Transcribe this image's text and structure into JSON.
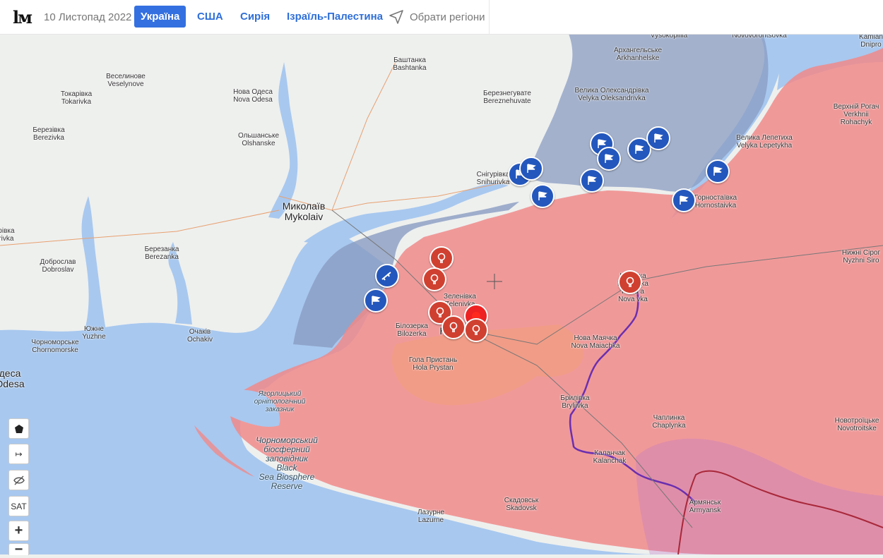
{
  "header": {
    "logo": "lм",
    "date": "10 Листопад 2022",
    "tabs": [
      {
        "label": "Україна",
        "active": true
      },
      {
        "label": "США",
        "active": false
      },
      {
        "label": "Сирія",
        "active": false
      },
      {
        "label": "Ізраїль-Палестина",
        "active": false
      }
    ],
    "region_select_label": "Обрати регіони"
  },
  "colors": {
    "occupied": "#f08a8a",
    "liberated": "#8a9cc2",
    "water": "#a8c8ef",
    "flag_marker": "#2357bd",
    "explosion_marker": "#d04030",
    "purple_border": "#6a2fb0",
    "crimea_border": "#a8283a"
  },
  "places": [
    {
      "name": "Veselynove",
      "text": "Веселинове\nVeselynove"
    },
    {
      "name": "Tokarivka",
      "text": "Токарівка\nTokarivka"
    },
    {
      "name": "Nova Odesa",
      "text": "Нова Одеса\nNova Odesa"
    },
    {
      "name": "Bashtanka",
      "text": "Баштанка\nBashtanka"
    },
    {
      "name": "Bereznehuvate",
      "text": "Березнегувате\nBereznehuvate"
    },
    {
      "name": "Vysokopillia",
      "text": "Vysokopillia"
    },
    {
      "name": "Novovorontsovka",
      "text": "Novovorontsovka"
    },
    {
      "name": "Kamianka-Dniprovska",
      "text": "Kamian\nDnipro"
    },
    {
      "name": "Arkhanhelske",
      "text": "Архангельське\nArkhanhelske"
    },
    {
      "name": "Velyka Oleksandrivka",
      "text": "Велика Олександрівка\nVelyka Oleksandrivka"
    },
    {
      "name": "Verkhnii Rohachyk",
      "text": "Верхній Рогач\nVerkhnii\nRohachyk"
    },
    {
      "name": "Berezivka",
      "text": "Березівка\nBerezivka"
    },
    {
      "name": "Olshanske",
      "text": "Ольшанське\nOlshanske"
    },
    {
      "name": "Velyka Lepetykha",
      "text": "Велика Лепетиха\nVelyka Lepetykha"
    },
    {
      "name": "Snihurivka",
      "text": "Снігурівка\nSnihurivka"
    },
    {
      "name": "Hornostaivka",
      "text": "Горностаївка\nHornostaivka"
    },
    {
      "name": "Mykolaiv",
      "text": "Миколаїв\nMykolaiv"
    },
    {
      "name": "Dobroslav",
      "text": "Доброслав\nDobroslav"
    },
    {
      "name": "Berezanka",
      "text": "Березанка\nBerezanka"
    },
    {
      "name": "Yuzhne",
      "text": "Южне\nYuzhne"
    },
    {
      "name": "Ochakiv",
      "text": "Очаків\nOchakiv"
    },
    {
      "name": "Chornomorske",
      "text": "Чорноморське\nChornomorske"
    },
    {
      "name": "Odesa",
      "text": "деса\nOdesa"
    },
    {
      "name": "Zelenivka",
      "text": "Зеленівка\nZelenivka"
    },
    {
      "name": "Bilozerka",
      "text": "Білозерка\nBilozerka"
    },
    {
      "name": "Kherson",
      "text": "Кх"
    },
    {
      "name": "Hola Prystan",
      "text": "Гола Пристань\nHola Prystan"
    },
    {
      "name": "Nova Kakhovka",
      "text": "Каховка\nKakhovka\nНова     а\nNova      vka"
    },
    {
      "name": "Nova Maiachka",
      "text": "Нова Маячка\nNova Maiachka"
    },
    {
      "name": "Nyzhni Sirohozy",
      "text": "Нижні Сірог\nNyzhni Siro"
    },
    {
      "name": "Bryliivka",
      "text": "Брилівка\nBryliivka"
    },
    {
      "name": "Chaplynka",
      "text": "Чаплинка\nChaplynka"
    },
    {
      "name": "Novotroitske",
      "text": "Новотроїцьке\nNovotroitske"
    },
    {
      "name": "Kalanchak",
      "text": "Каланчак\nKalanchak"
    },
    {
      "name": "Skadovsk",
      "text": "Скадовськ\nSkadovsk"
    },
    {
      "name": "Lazurne",
      "text": "Лазурне\nLazurne"
    },
    {
      "name": "Armiansk",
      "text": "Армянськ\nArmyansk"
    },
    {
      "name": "Trykhatky",
      "text": "ігрівка\nTrivka"
    }
  ],
  "water_labels": [
    {
      "name": "Yahorlytskyi reserve",
      "text": "Ягорлицький\nорнітологічний\nзаказник"
    },
    {
      "name": "Black Sea Biosphere Reserve",
      "text": "Чорноморський\nбіосферний\nзаповідник\nBlack\nSea Biosphere\nReserve"
    }
  ],
  "markers": [
    {
      "type": "flag",
      "icon": "flag-icon",
      "place": "Snihurivka 1"
    },
    {
      "type": "flag",
      "icon": "flag-icon",
      "place": "Snihurivka 2"
    },
    {
      "type": "flag",
      "icon": "flag-icon",
      "place": "Arkhanhelske south 1"
    },
    {
      "type": "flag",
      "icon": "flag-icon",
      "place": "Arkhanhelske south 2"
    },
    {
      "type": "flag",
      "icon": "flag-icon",
      "place": "Velyka Oleksandrivka 1"
    },
    {
      "type": "flag",
      "icon": "flag-icon",
      "place": "Velyka Oleksandrivka 2"
    },
    {
      "type": "flag",
      "icon": "flag-icon",
      "place": "Snihurivka east"
    },
    {
      "type": "flag",
      "icon": "flag-icon",
      "place": "Mid river"
    },
    {
      "type": "flag",
      "icon": "flag-icon",
      "place": "Velyka Lepetykha"
    },
    {
      "type": "flag",
      "icon": "flag-icon",
      "place": "Hornostaivka"
    },
    {
      "type": "flag",
      "icon": "flag-icon",
      "place": "Mykolaiv south"
    },
    {
      "type": "weapon",
      "icon": "rifle-icon",
      "place": "Mykolaiv southeast"
    },
    {
      "type": "explosion",
      "icon": "explosion-icon",
      "place": "Kherson north 1"
    },
    {
      "type": "explosion",
      "icon": "explosion-icon",
      "place": "Kherson north 2"
    },
    {
      "type": "explosion",
      "icon": "explosion-icon",
      "place": "Bilozerka"
    },
    {
      "type": "explosion",
      "icon": "explosion-icon",
      "place": "Kherson west"
    },
    {
      "type": "explosion",
      "icon": "explosion-icon",
      "place": "Kherson center"
    },
    {
      "type": "explosion",
      "icon": "explosion-icon",
      "place": "Kherson east"
    },
    {
      "type": "explosion",
      "icon": "explosion-icon",
      "place": "Nova Kakhovka"
    }
  ],
  "controls": {
    "draw_polygon": "pentagon-icon",
    "measure": "↦",
    "hide_layer": "eye-off-icon",
    "satellite": "SAT",
    "zoom_in": "+",
    "zoom_out": "−"
  }
}
